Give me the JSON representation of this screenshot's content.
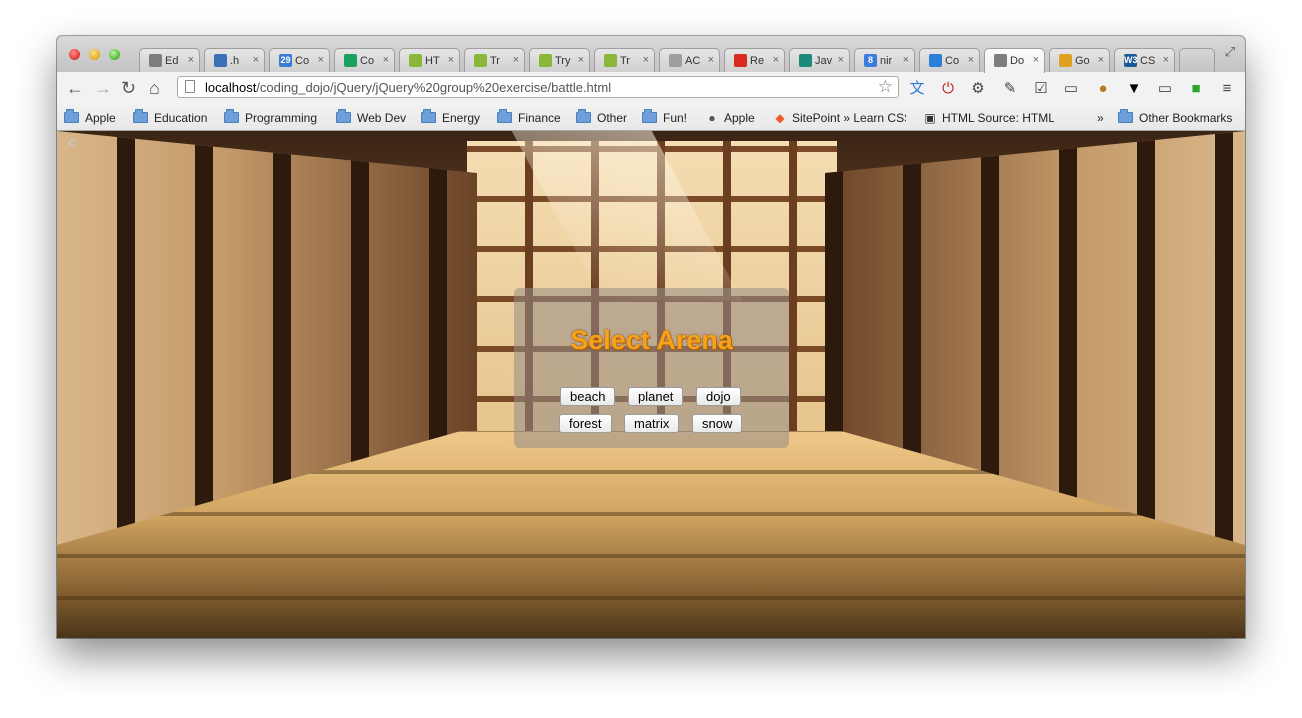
{
  "browser": {
    "tabs": [
      {
        "label": "Ed",
        "icon": "puzzle-icon",
        "color": "#7d7d7d"
      },
      {
        "label": ".h",
        "icon": "swirl-icon",
        "color": "#3b6fb6"
      },
      {
        "label": "Co",
        "icon": "calendar-icon",
        "color": "#3a7bd5",
        "badge": "29"
      },
      {
        "label": "Co",
        "icon": "spreadsheet-icon",
        "color": "#1aa15f"
      },
      {
        "label": "HT",
        "icon": "w3-icon",
        "color": "#8ab73a"
      },
      {
        "label": "Tr",
        "icon": "w3-icon",
        "color": "#8ab73a"
      },
      {
        "label": "Try",
        "icon": "w3-icon",
        "color": "#8ab73a"
      },
      {
        "label": "Tr",
        "icon": "w3-icon",
        "color": "#8ab73a"
      },
      {
        "label": "AC",
        "icon": "page-icon",
        "color": "#9e9e9e"
      },
      {
        "label": "Re",
        "icon": "record-icon",
        "color": "#d82b20"
      },
      {
        "label": "Jav",
        "icon": "plus-icon",
        "color": "#1a8a7a"
      },
      {
        "label": "nir",
        "icon": "google-plus-icon",
        "color": "#3b7ddd",
        "badge": "8"
      },
      {
        "label": "Co",
        "icon": "dropbox-icon",
        "color": "#2b7fd6"
      },
      {
        "label": "Do",
        "icon": "globe-icon",
        "color": "#7d7d7d",
        "active": true
      },
      {
        "label": "Go",
        "icon": "google-drive-icon",
        "color": "#e0a020"
      },
      {
        "label": "CS",
        "icon": "w3c-icon",
        "color": "#1a5a9a",
        "badge": "W3"
      }
    ],
    "close_glyph": "×",
    "url_host": "localhost",
    "url_path": "/coding_dojo/jQuery/jQuery%20group%20exercise/battle.html",
    "bookmarks": [
      {
        "label": "Apple",
        "type": "folder"
      },
      {
        "label": "Education",
        "type": "folder"
      },
      {
        "label": "Programming",
        "type": "folder"
      },
      {
        "label": "Web Dev",
        "type": "folder"
      },
      {
        "label": "Energy",
        "type": "folder"
      },
      {
        "label": "Finance",
        "type": "folder"
      },
      {
        "label": "Other",
        "type": "folder"
      },
      {
        "label": "Fun!",
        "type": "folder"
      },
      {
        "label": "Apple",
        "type": "apple"
      },
      {
        "label": "SitePoint » Learn CSS",
        "type": "sitepoint"
      },
      {
        "label": "HTML Source: HTML",
        "type": "html"
      }
    ],
    "bookmarks_overflow": "»",
    "other_bookmarks": "Other Bookmarks"
  },
  "page": {
    "modal_title": "Select Arena",
    "arenas": [
      "beach",
      "planet",
      "dojo",
      "forest",
      "matrix",
      "snow"
    ],
    "title_color": "#f7a21b"
  }
}
